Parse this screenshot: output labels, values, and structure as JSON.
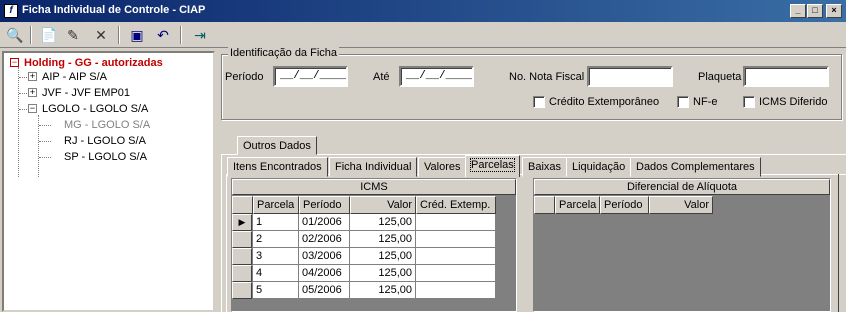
{
  "window": {
    "title": "Ficha Individual de Controle - CIAP",
    "buttons": [
      "_",
      "□",
      "×"
    ]
  },
  "toolbar": {
    "icons": [
      "binoculars-icon",
      "new-icon",
      "edit-icon",
      "delete-icon",
      "save-icon",
      "undo-icon",
      "exit-icon"
    ]
  },
  "tree": {
    "root": "Holding -  GG -  autorizadas",
    "items": [
      "AIP - AIP S/A",
      "JVF - JVF  EMP01",
      "LGOLO - LGOLO S/A",
      "MG - LGOLO S/A",
      "RJ - LGOLO S/A",
      "SP - LGOLO S/A"
    ]
  },
  "identificacao": {
    "title": "Identificação da Ficha",
    "periodo_label": "Período",
    "periodo_value": "__/__/____",
    "ate_label": "Até",
    "ate_value": "__/__/____",
    "nota_label": "No. Nota Fiscal",
    "nota_value": "",
    "plaqueta_label": "Plaqueta",
    "plaqueta_value": "",
    "chk_credito": "Crédito Extemporâneo",
    "chk_nfe": "NF-e",
    "chk_icms": "ICMS Diferido"
  },
  "tabs": {
    "outer": "Outros Dados",
    "inner": [
      "Itens Encontrados",
      "Ficha Individual",
      "Valores",
      "Parcelas",
      "Baixas",
      "Liquidação",
      "Dados Complementares"
    ],
    "active": "Parcelas"
  },
  "icms_grid": {
    "title": "ICMS",
    "columns": [
      "Parcela",
      "Período",
      "Valor",
      "Créd. Extemp."
    ],
    "rows": [
      [
        "1",
        "01/2006",
        "125,00",
        ""
      ],
      [
        "2",
        "02/2006",
        "125,00",
        ""
      ],
      [
        "3",
        "03/2006",
        "125,00",
        ""
      ],
      [
        "4",
        "04/2006",
        "125,00",
        ""
      ],
      [
        "5",
        "05/2006",
        "125,00",
        ""
      ]
    ]
  },
  "difal_grid": {
    "title": "Diferencial de Alíquota",
    "columns": [
      "Parcela",
      "Período",
      "Valor"
    ]
  }
}
